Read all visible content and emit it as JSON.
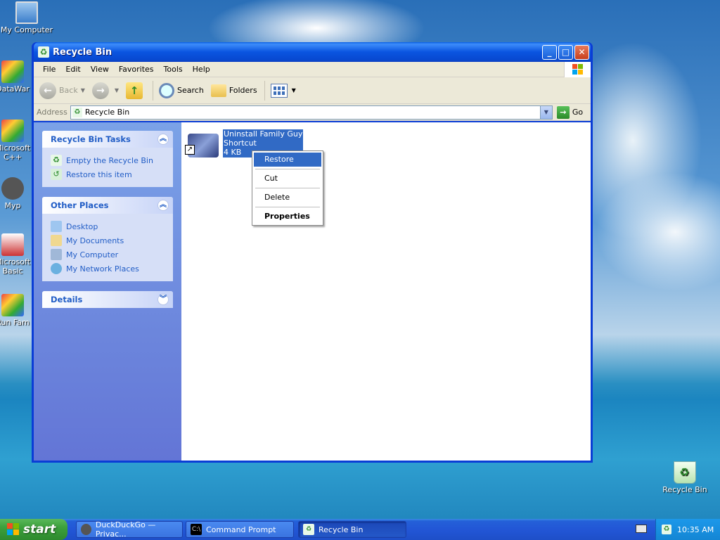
{
  "desktop": {
    "icons": [
      {
        "name": "my-computer-desktop-icon",
        "label": "My Computer"
      },
      {
        "name": "datawar-desktop-icon",
        "label": "DataWar"
      },
      {
        "name": "microsoft-cpp-desktop-icon",
        "label": "Microsoft C++"
      },
      {
        "name": "myp-desktop-icon",
        "label": "Myp"
      },
      {
        "name": "microsoft-basic-desktop-icon",
        "label": "Microsoft Basic"
      },
      {
        "name": "run-family-desktop-icon",
        "label": "Run Fam"
      },
      {
        "name": "recycle-bin-desktop-icon",
        "label": "Recycle Bin"
      }
    ]
  },
  "window": {
    "title": "Recycle Bin",
    "menu": [
      "File",
      "Edit",
      "View",
      "Favorites",
      "Tools",
      "Help"
    ],
    "toolbar": {
      "back": "Back",
      "search": "Search",
      "folders": "Folders"
    },
    "address": {
      "label": "Address",
      "value": "Recycle Bin",
      "go": "Go"
    },
    "taskpane": {
      "tasks_title": "Recycle Bin Tasks",
      "tasks": [
        "Empty the Recycle Bin",
        "Restore this item"
      ],
      "places_title": "Other Places",
      "places": [
        "Desktop",
        "My Documents",
        "My Computer",
        "My Network Places"
      ],
      "details_title": "Details"
    },
    "file": {
      "name_line1": "Uninstall Family Guy",
      "name_line2": "Shortcut",
      "size": "4 KB"
    },
    "context_menu": [
      "Restore",
      "Cut",
      "Delete",
      "Properties"
    ]
  },
  "taskbar": {
    "start": "start",
    "tasks": [
      "DuckDuckGo — Privac...",
      "Command Prompt",
      "Recycle Bin"
    ],
    "clock": "10:35 AM"
  },
  "colors": {
    "titlebar": "#0a55e0",
    "selection": "#316ac5",
    "link": "#215dc6"
  }
}
